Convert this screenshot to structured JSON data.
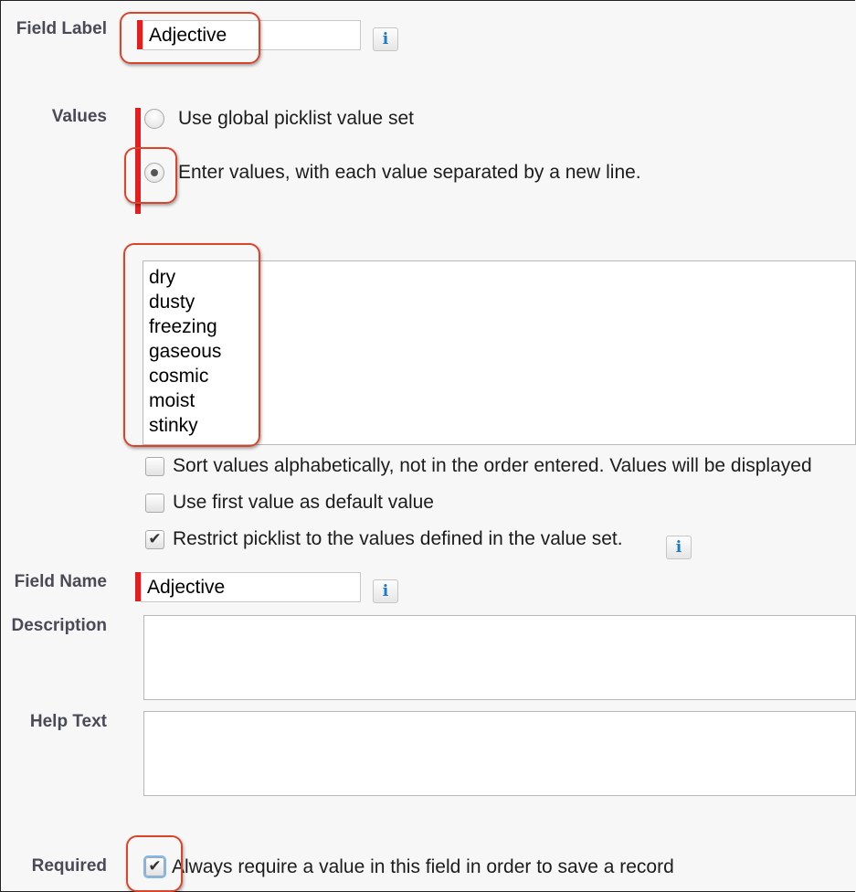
{
  "field_label": {
    "label": "Field Label",
    "value": "Adjective"
  },
  "values": {
    "label": "Values",
    "option_global": "Use global picklist value set",
    "option_enter": "Enter values, with each value separated by a new line.",
    "selected": "option_enter",
    "list": [
      "dry",
      "dusty",
      "freezing",
      "gaseous",
      "cosmic",
      "moist",
      "stinky"
    ]
  },
  "options": {
    "sort_label": "Sort values alphabetically, not in the order entered. Values will be displayed",
    "sort_checked": false,
    "default_label": "Use first value as default value",
    "default_checked": false,
    "restrict_label": "Restrict picklist to the values defined in the value set.",
    "restrict_checked": true
  },
  "field_name": {
    "label": "Field Name",
    "value": "Adjective"
  },
  "description": {
    "label": "Description",
    "value": ""
  },
  "help_text": {
    "label": "Help Text",
    "value": ""
  },
  "required": {
    "label": "Required",
    "text": "Always require a value in this field in order to save a record",
    "checked": true
  },
  "info_icon_glyph": "i",
  "check_glyph": "✔",
  "colors": {
    "required_bar": "#e41e1e",
    "highlight": "#d9452b",
    "info": "#1a7cc4"
  }
}
